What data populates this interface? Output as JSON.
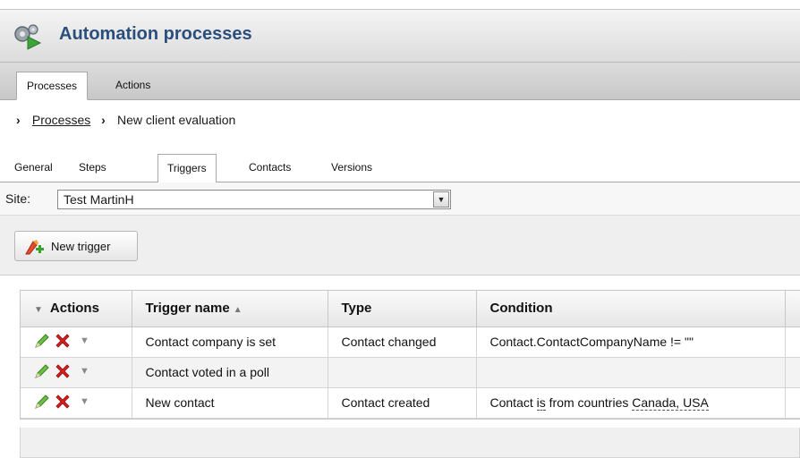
{
  "header": {
    "title": "Automation processes",
    "icon": "gears-play-icon"
  },
  "top_tabs": [
    {
      "label": "Processes",
      "active": true
    },
    {
      "label": "Actions",
      "active": false
    }
  ],
  "breadcrumb": {
    "parent": "Processes",
    "current": "New client evaluation"
  },
  "sub_tabs": [
    {
      "label": "General"
    },
    {
      "label": "Steps"
    },
    {
      "label": "Triggers",
      "active": true
    },
    {
      "label": "Contacts"
    },
    {
      "label": "Versions"
    }
  ],
  "site": {
    "label": "Site:",
    "value": "Test MartinH"
  },
  "toolbar": {
    "new_trigger_label": "New trigger"
  },
  "grid": {
    "columns": {
      "actions": "Actions",
      "name": "Trigger name",
      "type": "Type",
      "condition": "Condition"
    },
    "rows": [
      {
        "name": "Contact company is set",
        "type": "Contact changed",
        "condition": "Contact.ContactCompanyName != \"\""
      },
      {
        "name": "Contact voted in a poll",
        "type": "",
        "condition": ""
      },
      {
        "name": "New contact",
        "type": "Contact created",
        "condition_parts": {
          "p1": "Contact ",
          "p2": "is",
          "p3": " from countries ",
          "p4": "Canada, USA"
        }
      }
    ]
  },
  "colors": {
    "title": "#2b4f7c",
    "edit_icon": "#4f9a2e",
    "delete_icon": "#d41f1f"
  }
}
